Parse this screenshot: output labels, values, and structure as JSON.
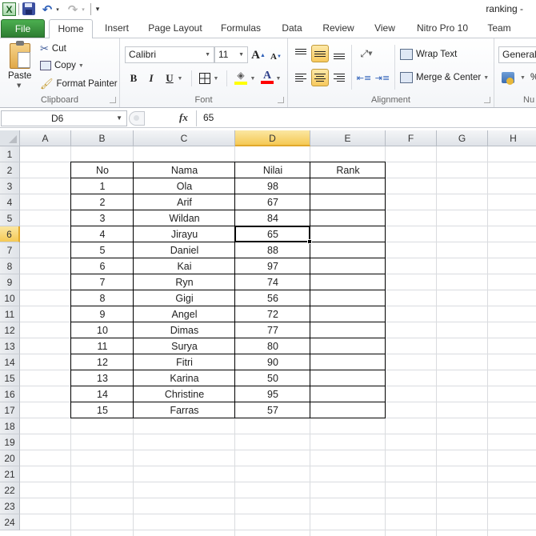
{
  "window": {
    "title": "ranking -"
  },
  "quick_access": {
    "items": [
      {
        "name": "excel-logo-icon",
        "glyph": "X"
      },
      {
        "name": "save-icon"
      },
      {
        "name": "undo-icon",
        "glyph": "↶"
      },
      {
        "name": "redo-icon",
        "glyph": "↷"
      },
      {
        "name": "customize-icon",
        "glyph": "▾"
      }
    ],
    "dropdown_glyph": "▾"
  },
  "tabs": [
    {
      "label": "File",
      "active": false
    },
    {
      "label": "Home",
      "active": true
    },
    {
      "label": "Insert"
    },
    {
      "label": "Page Layout"
    },
    {
      "label": "Formulas"
    },
    {
      "label": "Data"
    },
    {
      "label": "Review"
    },
    {
      "label": "View"
    },
    {
      "label": "Nitro Pro 10"
    },
    {
      "label": "Team"
    }
  ],
  "ribbon": {
    "clipboard": {
      "label": "Clipboard",
      "paste": "Paste",
      "cut": "Cut",
      "copy": "Copy",
      "format_painter": "Format Painter"
    },
    "font": {
      "label": "Font",
      "font_name": "Calibri",
      "font_size": "11",
      "grow": "A",
      "shrink": "A",
      "bold": "B",
      "italic": "I",
      "underline": "U",
      "fill_color": "#ffff00",
      "font_color": "#ff0000",
      "font_color_glyph": "A"
    },
    "alignment": {
      "label": "Alignment",
      "wrap_text": "Wrap Text",
      "merge_center": "Merge & Center",
      "active_vertical": "middle",
      "active_horizontal": "center"
    },
    "number": {
      "label": "Nu",
      "format": "General",
      "percent": "%"
    }
  },
  "formula_bar": {
    "name_box": "D6",
    "fx_label": "fx",
    "value": "65"
  },
  "sheet": {
    "columns": [
      "A",
      "B",
      "C",
      "D",
      "E",
      "F",
      "G",
      "H"
    ],
    "selected_column": "D",
    "rows": [
      "1",
      "2",
      "3",
      "4",
      "5",
      "6",
      "7",
      "8",
      "9",
      "10",
      "11",
      "12",
      "13",
      "14",
      "15",
      "16",
      "17",
      "18",
      "19",
      "20",
      "21",
      "22",
      "23",
      "24"
    ],
    "selected_row": "6",
    "active_cell": "D6",
    "table": {
      "headers": [
        "No",
        "Nama",
        "Nilai",
        "Rank"
      ],
      "rows": [
        {
          "no": "1",
          "nama": "Ola",
          "nilai": "98",
          "rank": ""
        },
        {
          "no": "2",
          "nama": "Arif",
          "nilai": "67",
          "rank": ""
        },
        {
          "no": "3",
          "nama": "Wildan",
          "nilai": "84",
          "rank": ""
        },
        {
          "no": "4",
          "nama": "Jirayu",
          "nilai": "65",
          "rank": ""
        },
        {
          "no": "5",
          "nama": "Daniel",
          "nilai": "88",
          "rank": ""
        },
        {
          "no": "6",
          "nama": "Kai",
          "nilai": "97",
          "rank": ""
        },
        {
          "no": "7",
          "nama": "Ryn",
          "nilai": "74",
          "rank": ""
        },
        {
          "no": "8",
          "nama": "Gigi",
          "nilai": "56",
          "rank": ""
        },
        {
          "no": "9",
          "nama": "Angel",
          "nilai": "72",
          "rank": ""
        },
        {
          "no": "10",
          "nama": "Dimas",
          "nilai": "77",
          "rank": ""
        },
        {
          "no": "11",
          "nama": "Surya",
          "nilai": "80",
          "rank": ""
        },
        {
          "no": "12",
          "nama": "Fitri",
          "nilai": "90",
          "rank": ""
        },
        {
          "no": "13",
          "nama": "Karina",
          "nilai": "50",
          "rank": ""
        },
        {
          "no": "14",
          "nama": "Christine",
          "nilai": "95",
          "rank": ""
        },
        {
          "no": "15",
          "nama": "Farras",
          "nilai": "57",
          "rank": ""
        }
      ]
    }
  }
}
